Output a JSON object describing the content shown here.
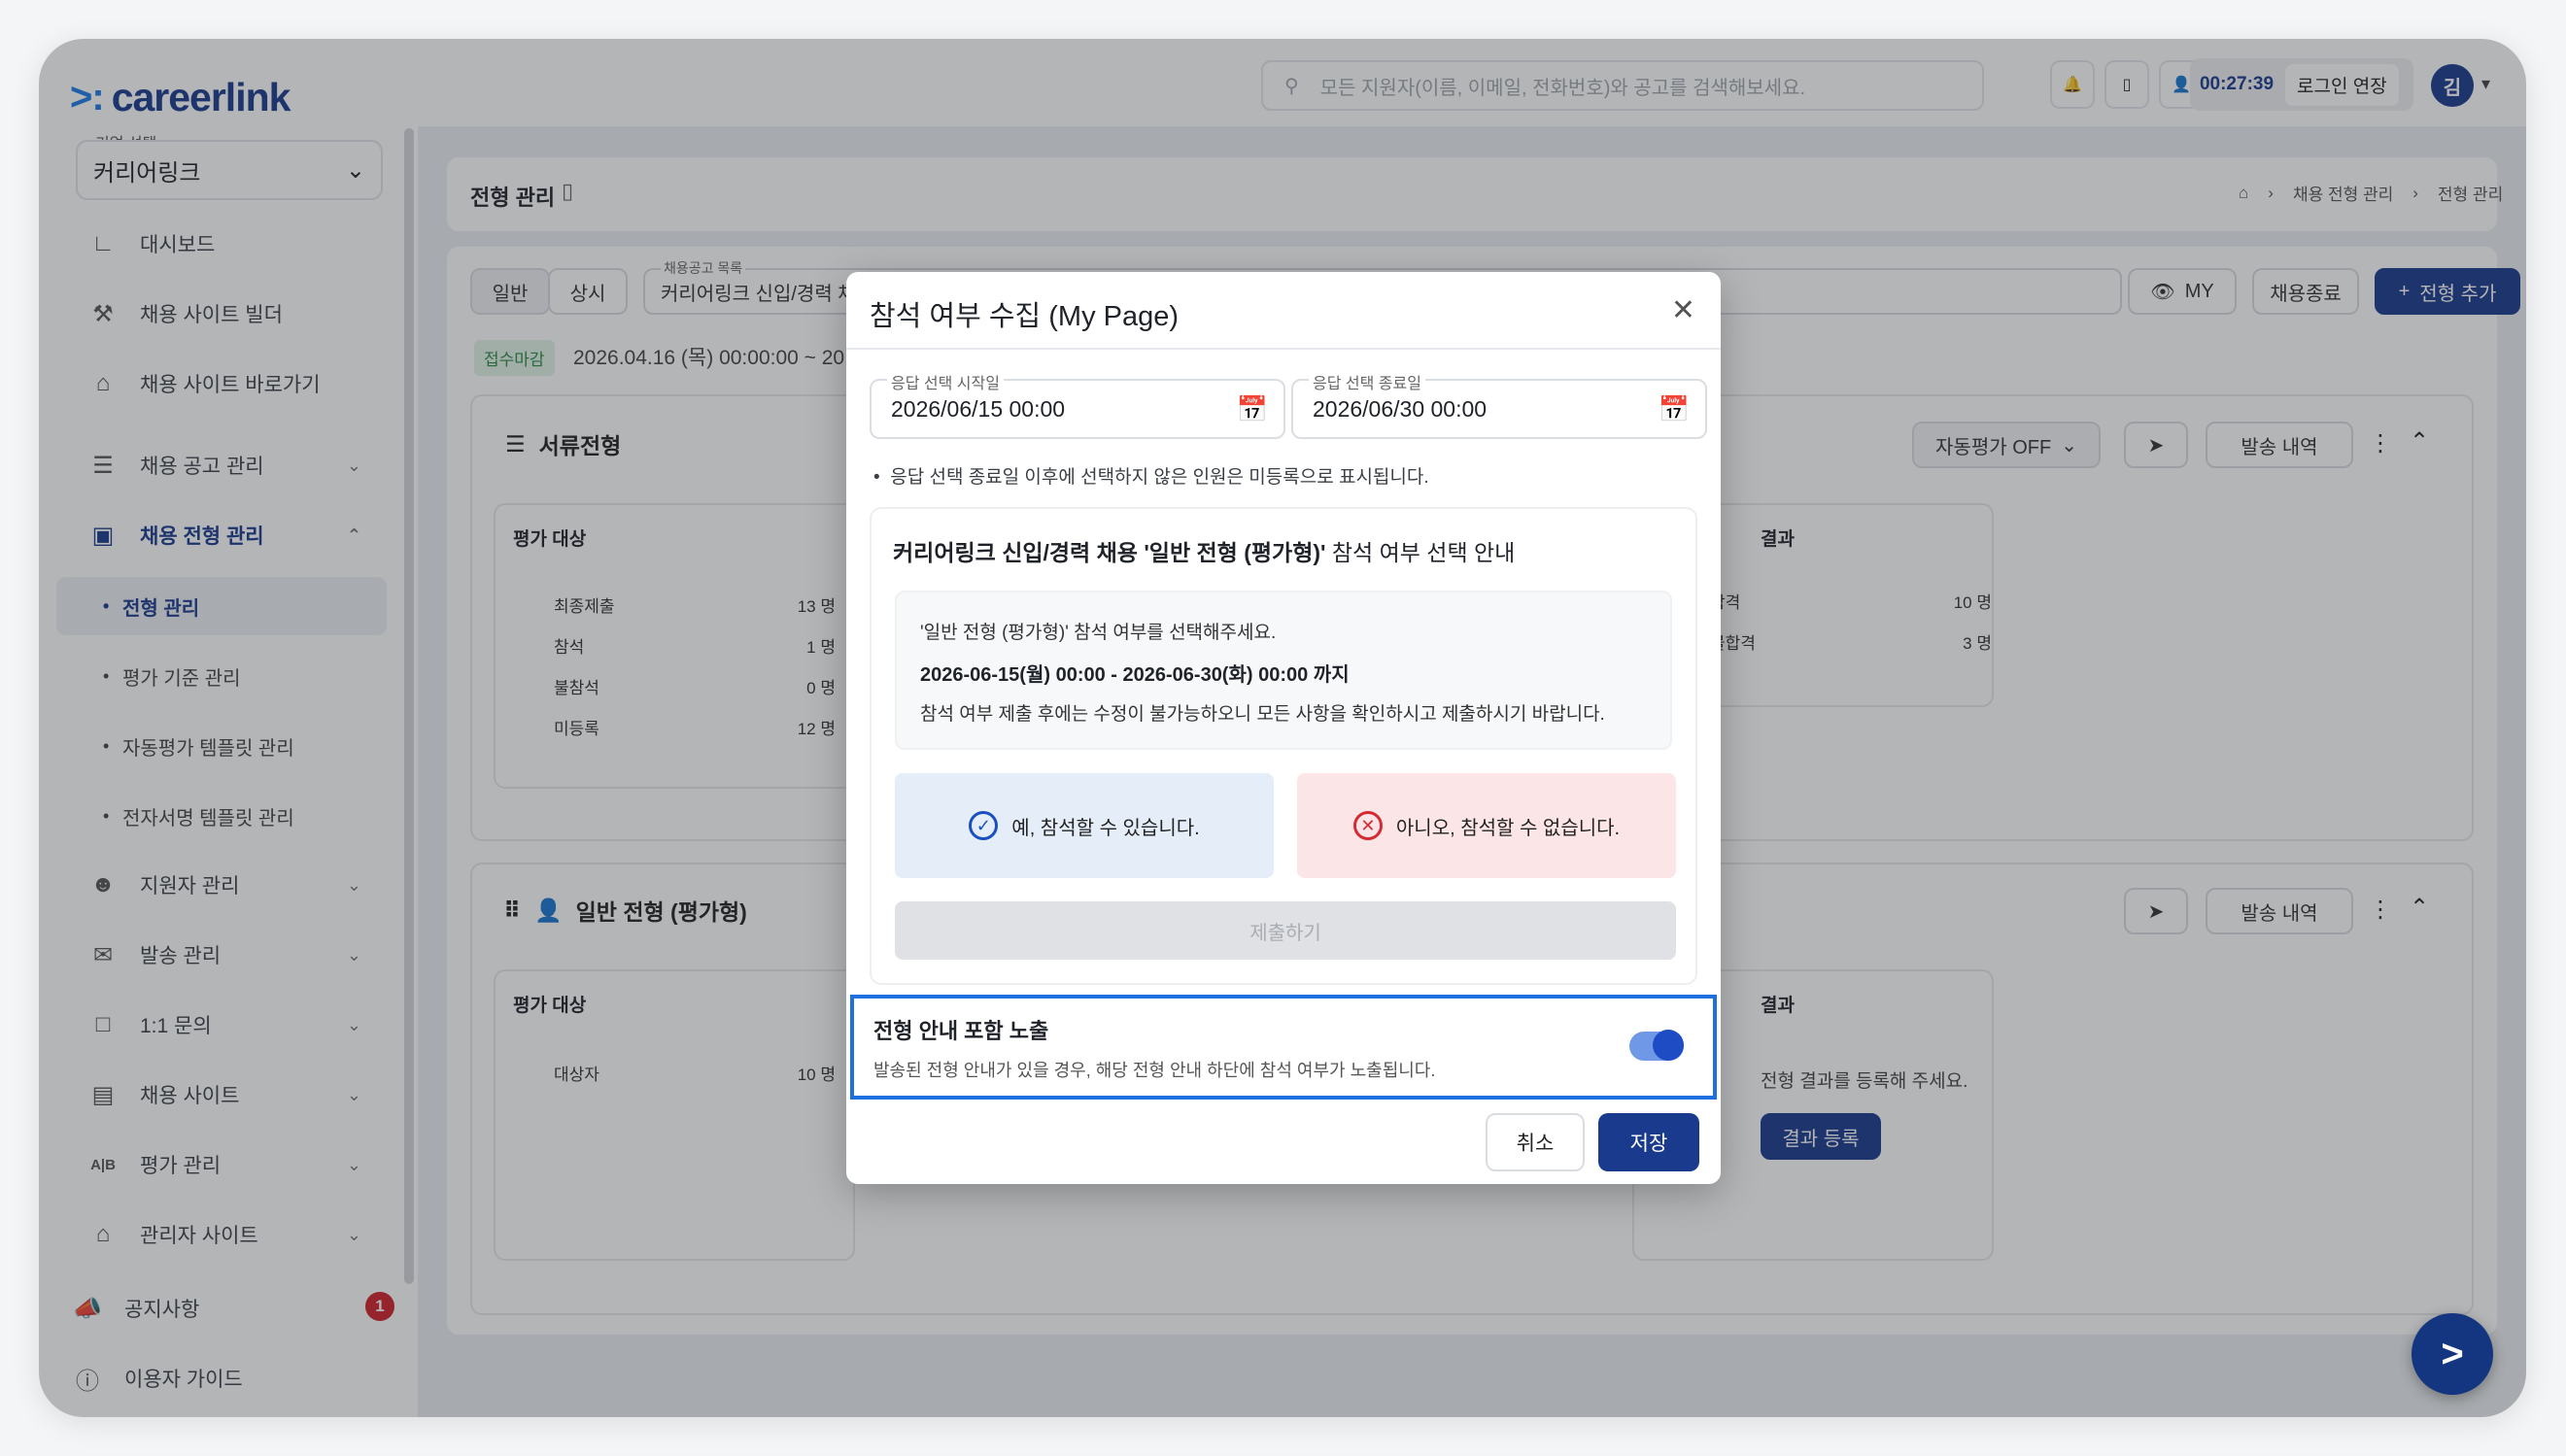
{
  "app": {
    "logo": "careerlink",
    "logo_mark": ">:"
  },
  "topbar": {
    "search_placeholder": "모든 지원자(이름, 이메일, 전화번호)와 공고를 검색해보세요.",
    "timer": "00:27:39",
    "extend_login": "로그인 연장",
    "avatar": "김"
  },
  "sidebar": {
    "company_label": "기업 선택",
    "company_value": "커리어링크",
    "items": [
      {
        "label": "대시보드",
        "icon": "chart-icon"
      },
      {
        "label": "채용 사이트 빌더",
        "icon": "tools-icon"
      },
      {
        "label": "채용 사이트 바로가기",
        "icon": "home-icon"
      },
      {
        "label": "채용 공고 관리",
        "icon": "list-icon"
      },
      {
        "label": "채용 전형 관리",
        "icon": "clipboard-icon"
      },
      {
        "label": "지원자 관리",
        "icon": "users-icon"
      },
      {
        "label": "발송 관리",
        "icon": "mail-icon"
      },
      {
        "label": "1:1 문의",
        "icon": "chat-icon"
      },
      {
        "label": "채용 사이트",
        "icon": "window-icon"
      },
      {
        "label": "평가 관리",
        "icon": "ab-icon"
      },
      {
        "label": "관리자 사이트",
        "icon": "home-gear-icon"
      }
    ],
    "sub_items": [
      "전형 관리",
      "평가 기준 관리",
      "자동평가 템플릿 관리",
      "전자서명 템플릿 관리"
    ],
    "notice": "공지사항",
    "notice_count": "1",
    "guide": "이용자 가이드"
  },
  "page": {
    "title": "전형 관리",
    "breadcrumb": [
      "채용 전형 관리",
      "전형 관리"
    ],
    "tab_general": "일반",
    "tab_always": "상시",
    "posting_label": "채용공고 목록",
    "posting_value": "커리어링크 신입/경력 채",
    "status_badge": "접수마감",
    "period": "2026.04.16 (목) 00:00:00 ~ 20",
    "btn_my": "MY",
    "btn_close": "채용종료",
    "btn_add": "전형 추가",
    "section1": {
      "title": "서류전형",
      "auto_eval": "자동평가 OFF",
      "history": "발송 내역",
      "eval_target": "평가 대상",
      "stats": [
        {
          "label": "최종제출",
          "value": "13 명"
        },
        {
          "label": "참석",
          "value": "1 명"
        },
        {
          "label": "불참석",
          "value": "0 명"
        },
        {
          "label": "미등록",
          "value": "12 명"
        }
      ],
      "result_title": "결과",
      "results": [
        {
          "label": "합격",
          "value": "10 명"
        },
        {
          "label": "불합격",
          "value": "3 명"
        }
      ]
    },
    "section2": {
      "title": "일반 전형 (평가형)",
      "history": "발송 내역",
      "eval_target": "평가 대상",
      "target_label": "대상자",
      "target_value": "10 명",
      "result_title": "결과",
      "result_hint": "전형 결과를 등록해 주세요.",
      "result_button": "결과 등록"
    }
  },
  "modal": {
    "title": "참석 여부 수집 (My Page)",
    "start_label": "응답 선택 시작일",
    "start_value": "2026/06/15 00:00",
    "end_label": "응답 선택 종료일",
    "end_value": "2026/06/30 00:00",
    "note": "응답 선택 종료일 이후에 선택하지 않은 인원은 미등록으로 표시됩니다.",
    "info_prefix": "커리어링크 신입/경력 채용  '일반 전형 (평가형)'",
    "info_suffix": " 참석 여부 선택 안내",
    "inner_line1": "'일반 전형 (평가형)' 참석 여부를 선택해주세요.",
    "inner_line2": "2026-06-15(월) 00:00 - 2026-06-30(화) 00:00 까지",
    "inner_line3": "참석 여부 제출 후에는 수정이 불가능하오니 모든 사항을 확인하시고 제출하시기 바랍니다.",
    "yes_label": "예, 참석할 수 있습니다.",
    "no_label": "아니오, 참석할 수 없습니다.",
    "submit_label": "제출하기",
    "toggle_title": "전형 안내 포함 노출",
    "toggle_desc": "발송된 전형 안내가 있을 경우, 해당 전형 안내 하단에 참석 여부가 노출됩니다.",
    "toggle_on": true,
    "cancel_label": "취소",
    "save_label": "저장"
  },
  "colors": {
    "brand": "#1a3a8e",
    "accent": "#1f6fe0",
    "danger": "#d42a34"
  }
}
